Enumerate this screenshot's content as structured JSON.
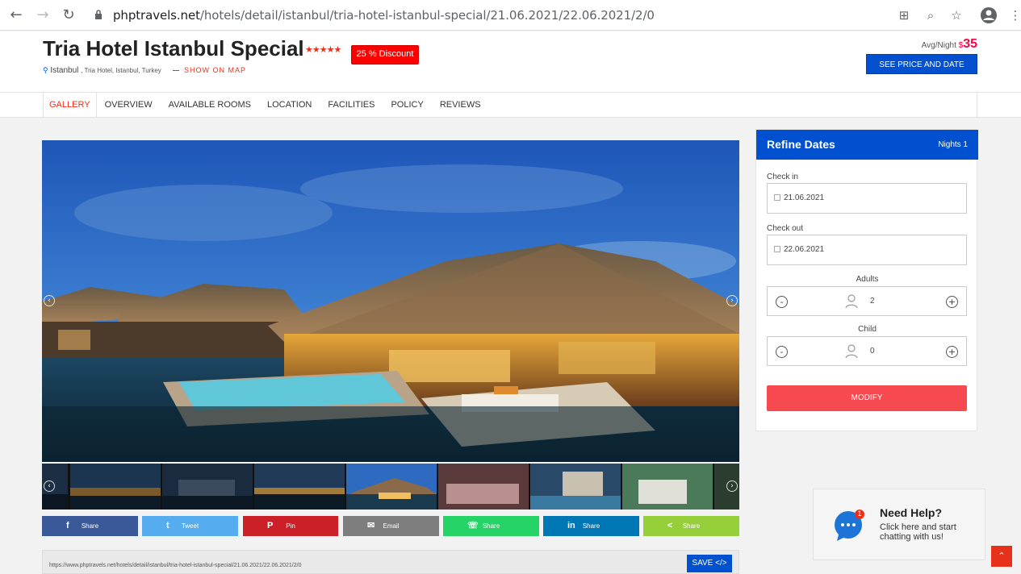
{
  "browser": {
    "url_host": "phptravels.net",
    "url_path": "/hotels/detail/istanbul/tria-hotel-istanbul-special/21.06.2021/22.06.2021/2/0"
  },
  "hotel": {
    "name": "Tria Hotel Istanbul Special",
    "stars": "★★★★★",
    "discount": "25 % Discount",
    "city": "Istanbul",
    "address": ", Tria Hotel, Istanbul, Turkey",
    "show_on_map": "SHOW ON MAP",
    "avg_label": "Avg/Night",
    "currency": "$",
    "price": "35",
    "see_price_button": "SEE PRICE AND DATE"
  },
  "tabs": [
    {
      "label": "GALLERY"
    },
    {
      "label": "OVERVIEW"
    },
    {
      "label": "AVAILABLE ROOMS"
    },
    {
      "label": "LOCATION"
    },
    {
      "label": "FACILITIES"
    },
    {
      "label": "POLICY"
    },
    {
      "label": "REVIEWS"
    }
  ],
  "share": [
    {
      "label": "Share",
      "icon": "facebook-icon",
      "glyph": "f",
      "color": "#3b5998"
    },
    {
      "label": "Tweet",
      "icon": "twitter-icon",
      "glyph": "t",
      "color": "#55acee"
    },
    {
      "label": "Pin",
      "icon": "pinterest-icon",
      "glyph": "P",
      "color": "#cb2027"
    },
    {
      "label": "Email",
      "icon": "email-icon",
      "glyph": "✉",
      "color": "#7d7d7d"
    },
    {
      "label": "Share",
      "icon": "whatsapp-icon",
      "glyph": "☏",
      "color": "#25d366"
    },
    {
      "label": "Share",
      "icon": "linkedin-icon",
      "glyph": "in",
      "color": "#0077b5"
    },
    {
      "label": "Share",
      "icon": "share-icon",
      "glyph": "<",
      "color": "#95d03a"
    }
  ],
  "share_url": "https://www.phptravels.net/hotels/detail/istanbul/tria-hotel-istanbul-special/21.06.2021/22.06.2021/2/0",
  "save_label": "SAVE",
  "refine": {
    "title": "Refine Dates",
    "nights": "Nights 1",
    "checkin_label": "Check in",
    "checkin_value": "21.06.2021",
    "checkout_label": "Check out",
    "checkout_value": "22.06.2021",
    "adults_label": "Adults",
    "adults_value": "2",
    "child_label": "Child",
    "child_value": "0",
    "minus": "-",
    "plus": "+",
    "modify_label": "MODIFY"
  },
  "help": {
    "title": "Need Help?",
    "subtitle": "Click here and start chatting with us!",
    "badge": "1"
  }
}
